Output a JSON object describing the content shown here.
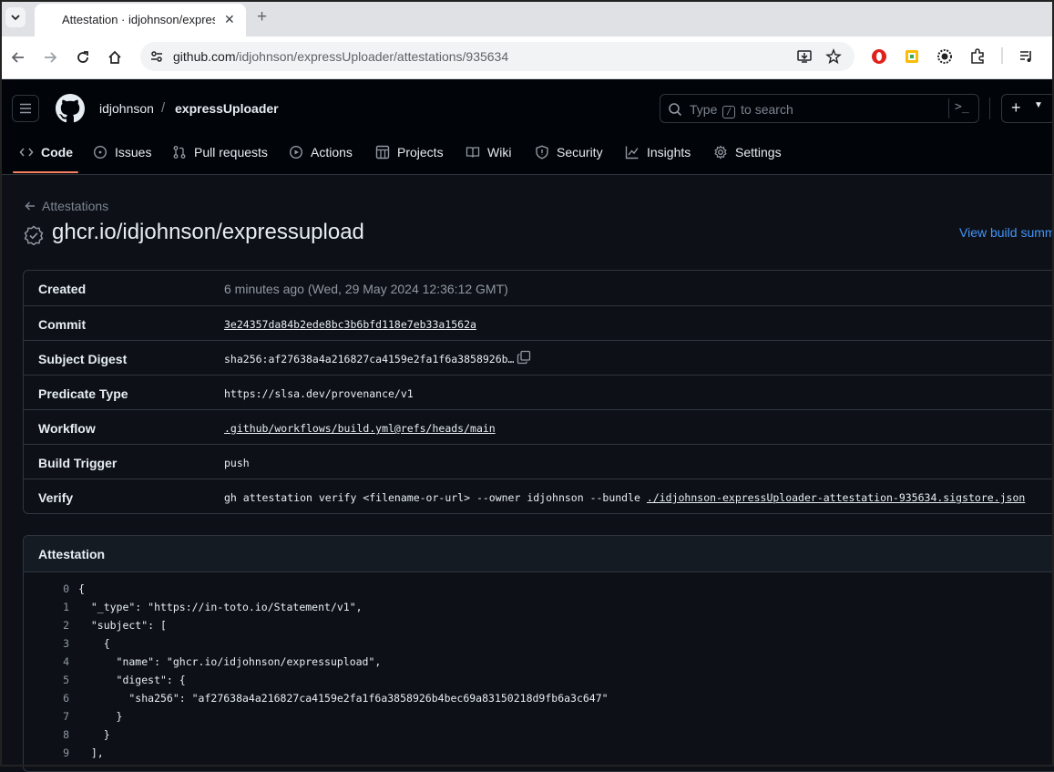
{
  "browser": {
    "tab_title": "Attestation · idjohnson/expressUploader",
    "url_host": "github.com",
    "url_path": "/idjohnson/expressUploader/attestations/935634"
  },
  "header": {
    "owner": "idjohnson",
    "separator": "/",
    "repo": "expressUploader",
    "search_before": "Type",
    "search_key": "/",
    "search_after": "to search"
  },
  "nav": {
    "items": [
      {
        "label": "Code",
        "icon": "code-icon"
      },
      {
        "label": "Issues",
        "icon": "issue-icon"
      },
      {
        "label": "Pull requests",
        "icon": "pull-request-icon"
      },
      {
        "label": "Actions",
        "icon": "play-icon"
      },
      {
        "label": "Projects",
        "icon": "table-icon"
      },
      {
        "label": "Wiki",
        "icon": "book-icon"
      },
      {
        "label": "Security",
        "icon": "shield-icon"
      },
      {
        "label": "Insights",
        "icon": "graph-icon"
      },
      {
        "label": "Settings",
        "icon": "gear-icon"
      }
    ]
  },
  "page": {
    "back_label": "Attestations",
    "title": "ghcr.io/idjohnson/expressupload",
    "view_summary": "View build summary"
  },
  "details": {
    "created_label": "Created",
    "created_value": "6 minutes ago (Wed, 29 May 2024 12:36:12 GMT)",
    "commit_label": "Commit",
    "commit_value": "3e24357da84b2ede8bc3b6bfd118e7eb33a1562a",
    "subject_label": "Subject Digest",
    "subject_value": "sha256:af27638a4a216827ca4159e2fa1f6a3858926b…",
    "predicate_label": "Predicate Type",
    "predicate_value": "https://slsa.dev/provenance/v1",
    "workflow_label": "Workflow",
    "workflow_value": ".github/workflows/build.yml@refs/heads/main",
    "trigger_label": "Build Trigger",
    "trigger_value": "push",
    "verify_label": "Verify",
    "verify_cmd": "gh attestation verify <filename-or-url> --owner idjohnson --bundle ",
    "verify_link": "./idjohnson-expressUploader-attestation-935634.sigstore.json"
  },
  "attestation": {
    "title": "Attestation",
    "lines": [
      {
        "n": "0",
        "t": "{"
      },
      {
        "n": "1",
        "t": "  \"_type\": \"https://in-toto.io/Statement/v1\","
      },
      {
        "n": "2",
        "t": "  \"subject\": ["
      },
      {
        "n": "3",
        "t": "    {"
      },
      {
        "n": "4",
        "t": "      \"name\": \"ghcr.io/idjohnson/expressupload\","
      },
      {
        "n": "5",
        "t": "      \"digest\": {"
      },
      {
        "n": "6",
        "t": "        \"sha256\": \"af27638a4a216827ca4159e2fa1f6a3858926b4bec69a83150218d9fb6a3c647\""
      },
      {
        "n": "7",
        "t": "      }"
      },
      {
        "n": "8",
        "t": "    }"
      },
      {
        "n": "9",
        "t": "  ],"
      }
    ]
  }
}
